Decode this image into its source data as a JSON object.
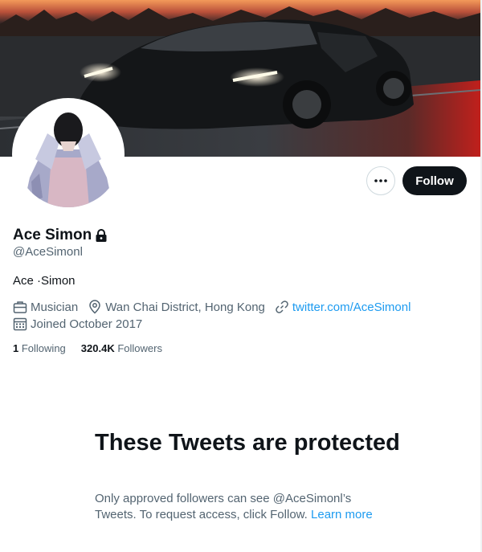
{
  "profile": {
    "display_name": "Ace Simon",
    "handle": "@AceSimonl",
    "bio": "Ace ·Simon",
    "category": "Musician",
    "location": "Wan Chai District, Hong Kong",
    "website": "twitter.com/AceSimonl",
    "joined": "Joined October 2017",
    "following_count": "1",
    "following_label": "Following",
    "followers_count": "320.4K",
    "followers_label": "Followers",
    "protected": true
  },
  "actions": {
    "follow_label": "Follow",
    "more_icon": "ellipsis-icon"
  },
  "protected_notice": {
    "title": "These Tweets are protected",
    "body": "Only approved followers can see @AceSimonl’s Tweets. To request access, click Follow.",
    "learn_more": "Learn more"
  },
  "icons": [
    "lock-icon",
    "briefcase-icon",
    "location-pin-icon",
    "link-icon",
    "calendar-icon",
    "ellipsis-icon"
  ],
  "colors": {
    "accent": "#1d9bf0",
    "text_primary": "#0f1419",
    "text_secondary": "#536471",
    "follow_button_bg": "#0f1419"
  }
}
